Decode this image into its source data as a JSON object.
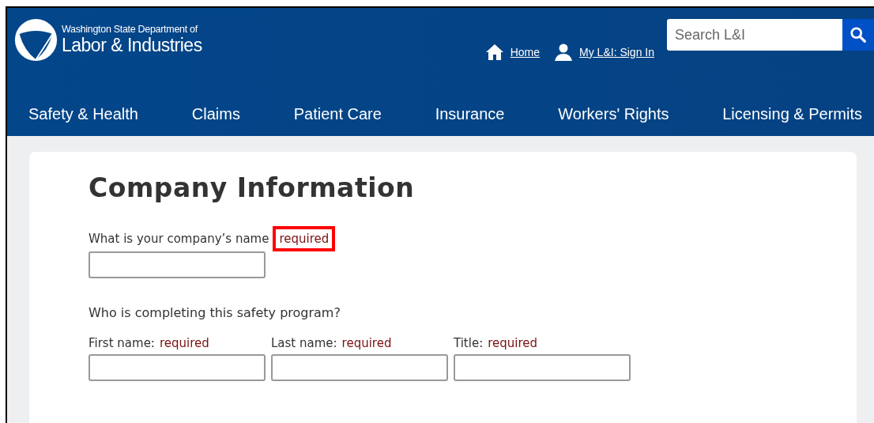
{
  "header": {
    "agency_line": "Washington State Department of",
    "agency_name": "Labor & Industries",
    "links": [
      {
        "kind": "home",
        "label": "Home"
      },
      {
        "kind": "person",
        "label": "My L&I: Sign In"
      }
    ],
    "search": {
      "placeholder": "Search L&I"
    }
  },
  "nav": [
    {
      "label": "Safety & Health"
    },
    {
      "label": "Claims"
    },
    {
      "label": "Patient Care"
    },
    {
      "label": "Insurance"
    },
    {
      "label": "Workers' Rights"
    },
    {
      "label": "Licensing & Permits"
    }
  ],
  "form": {
    "title": "Company Information",
    "company_field": {
      "label": "What is your company’s name",
      "required": "required",
      "highlighted": true
    },
    "section_label": "Who is completing this safety program?",
    "person_fields": [
      {
        "label": "First name:",
        "required": "required",
        "highlighted": false
      },
      {
        "label": "Last name:",
        "required": "required",
        "highlighted": false
      },
      {
        "label": "Title:",
        "required": "required",
        "highlighted": false
      }
    ]
  }
}
